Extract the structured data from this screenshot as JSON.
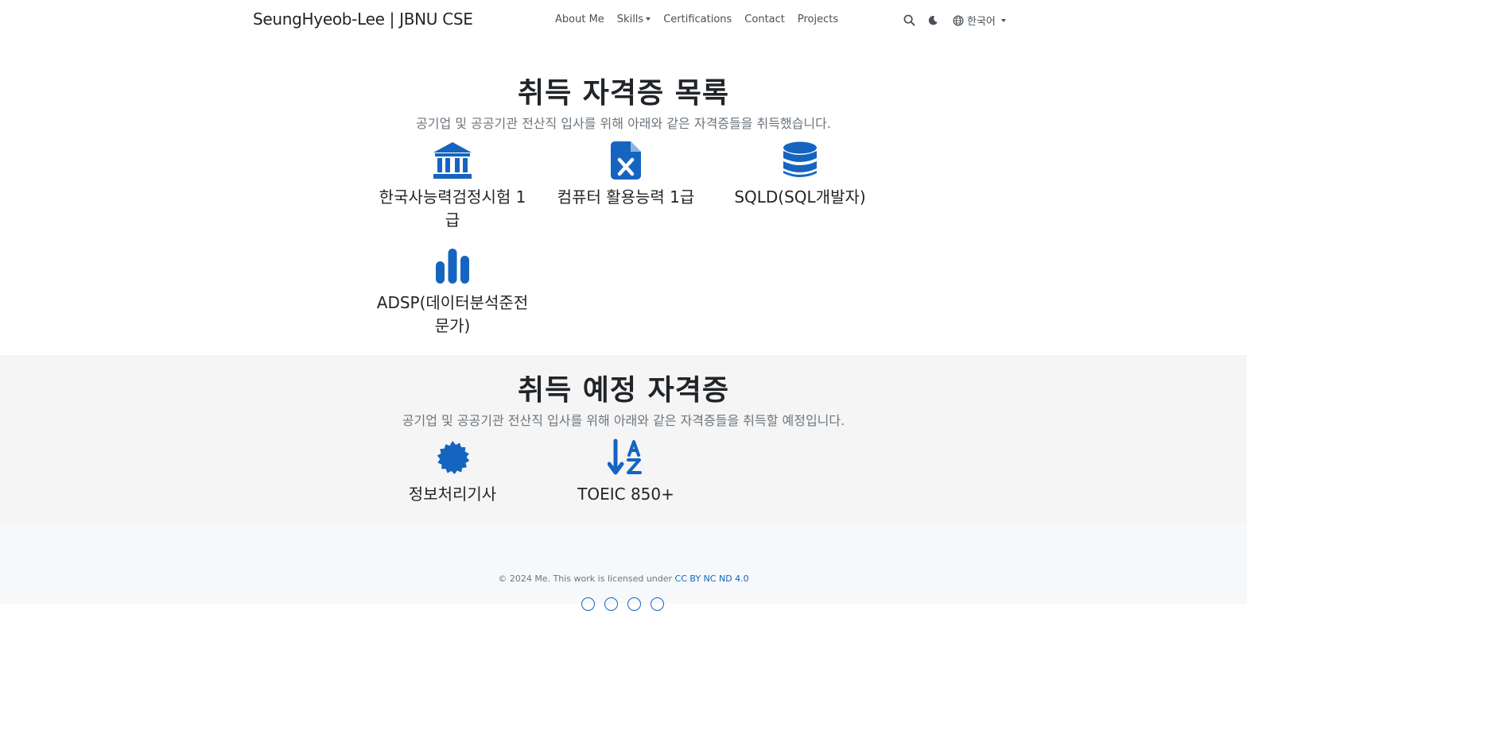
{
  "nav": {
    "brand": "SeungHyeob-Lee | JBNU CSE",
    "links": [
      "About Me",
      "Skills",
      "Certifications",
      "Contact",
      "Projects"
    ],
    "language": "한국어",
    "icons": [
      "search-icon",
      "moon-icon",
      "globe-icon"
    ]
  },
  "acquired": {
    "title": "취득 자격증 목록",
    "subtitle": "공기업 및 공공기관 전산직 입사를 위해 아래와 같은 자격증들을 취득했습니다.",
    "items": [
      {
        "icon": "landmark-icon",
        "label": "한국사능력검정시험 1급"
      },
      {
        "icon": "file-excel-icon",
        "label": "컴퓨터 활용능력 1급"
      },
      {
        "icon": "database-icon",
        "label": "SQLD(SQL개발자)"
      },
      {
        "icon": "bar-chart-icon",
        "label": "ADSP(데이터분석준전문가)"
      }
    ]
  },
  "planned": {
    "title": "취득 예정 자격증",
    "subtitle": "공기업 및 공공기관 전산직 입사를 위해 아래와 같은 자격증들을 취득할 예정입니다.",
    "items": [
      {
        "icon": "certificate-badge-icon",
        "label": "정보처리기사"
      },
      {
        "icon": "sort-alpha-down-icon",
        "label": "TOEIC 850+"
      }
    ]
  },
  "footer": {
    "text": "© 2024 Me. This work is licensed under",
    "license_link": "CC BY NC ND 4.0"
  },
  "colors": {
    "accent": "#1565c0",
    "text": "#212529",
    "muted": "#6c757d",
    "band": "#f5f5f5",
    "footer_bg": "#f6f8fa"
  }
}
